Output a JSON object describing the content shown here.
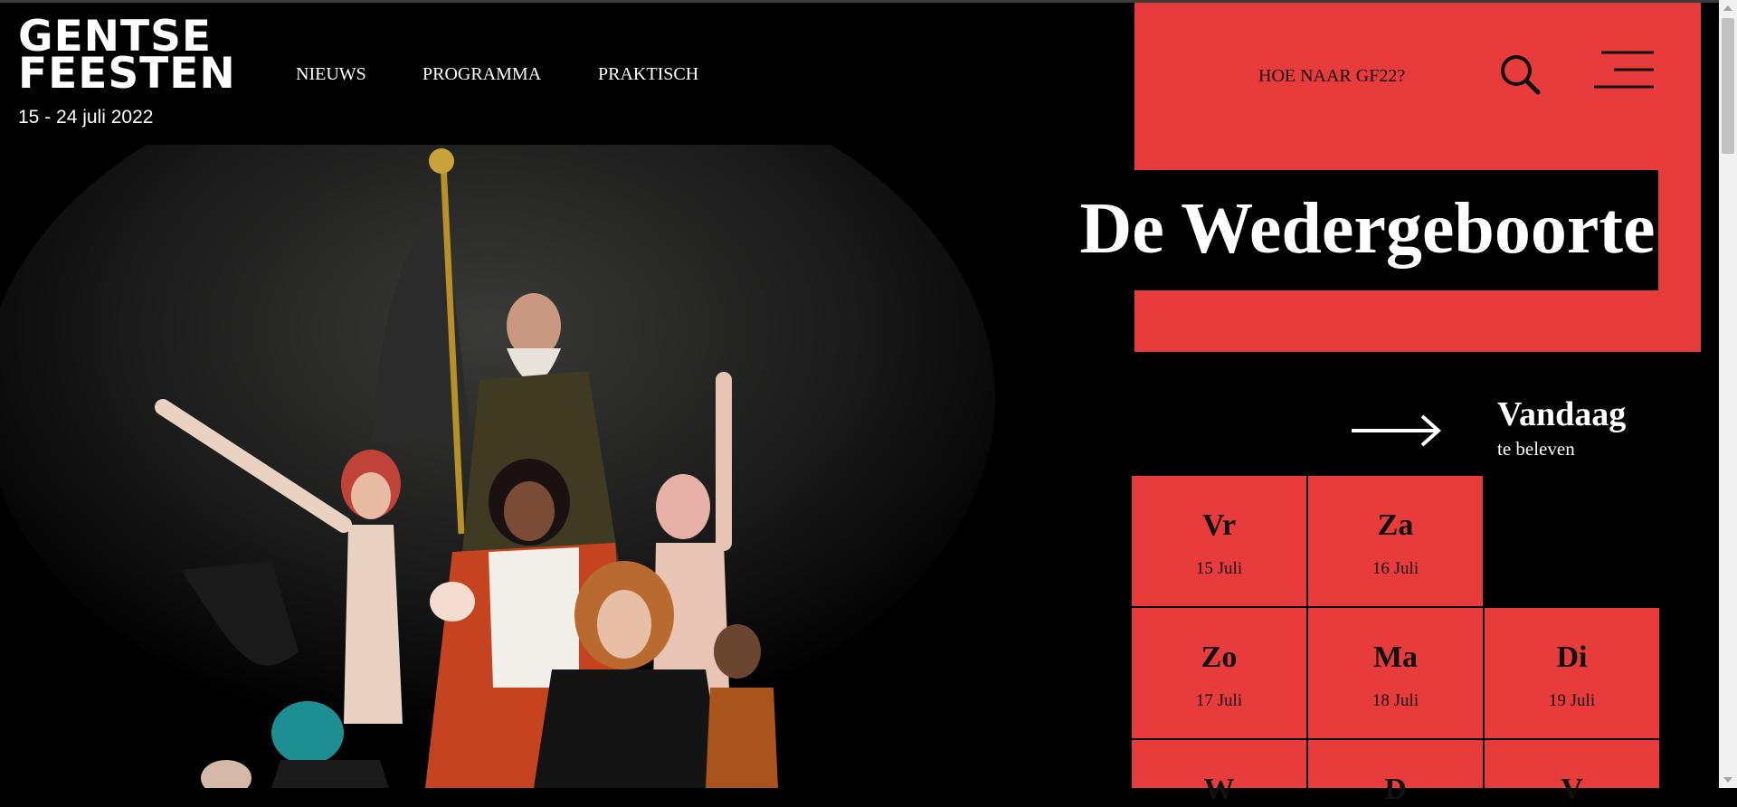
{
  "logo": {
    "line1": "GENTSE",
    "line2": "FEESTEN",
    "dates": "15 - 24 juli 2022"
  },
  "nav": {
    "items": [
      "NIEUWS",
      "PROGRAMMA",
      "PRAKTISCH"
    ]
  },
  "header": {
    "directions_link": "HOE NAAR GF22?",
    "search_icon": "search-icon",
    "menu_icon": "menu-icon"
  },
  "hero": {
    "title": "De Wedergeboorte"
  },
  "today": {
    "title": "Vandaag",
    "subtitle": "te beleven",
    "arrow_icon": "arrow-right-icon"
  },
  "days": [
    {
      "abbr": "Vr",
      "date": "15 Juli"
    },
    {
      "abbr": "Za",
      "date": "16 Juli"
    },
    {
      "abbr": "Zo",
      "date": "17 Juli"
    },
    {
      "abbr": "Ma",
      "date": "18 Juli"
    },
    {
      "abbr": "Di",
      "date": "19 Juli"
    },
    {
      "abbr": "W"
    },
    {
      "abbr": "D"
    },
    {
      "abbr": "V"
    }
  ],
  "colors": {
    "accent": "#e73b3c",
    "background": "#000000",
    "text": "#ffffff"
  }
}
